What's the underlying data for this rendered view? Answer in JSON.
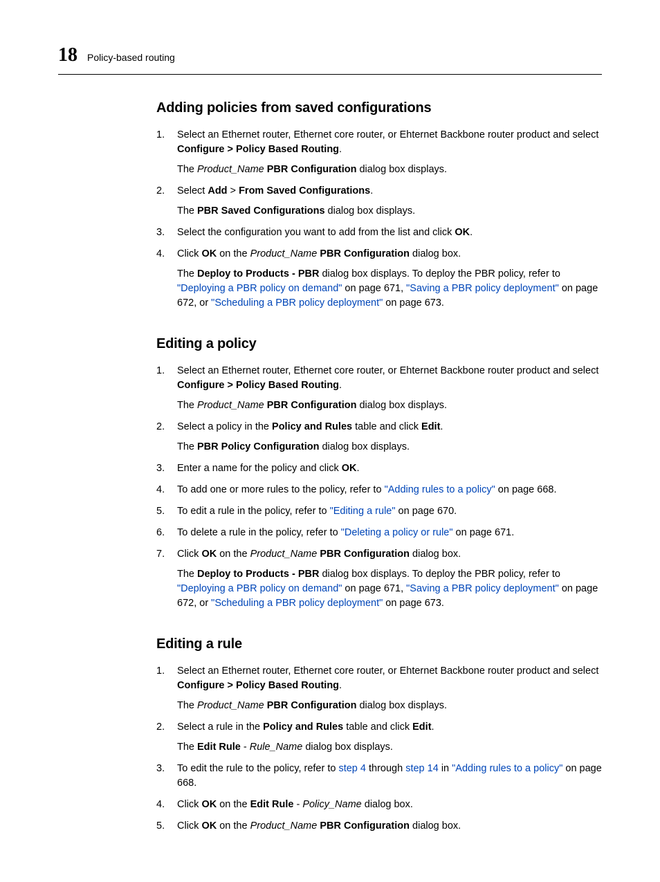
{
  "header": {
    "chapter": "18",
    "title": "Policy-based routing"
  },
  "sections": {
    "s1": {
      "title": "Adding policies from saved configurations",
      "step1_a": "Select an Ethernet router, Ethernet core router, or Ehternet Backbone router product and select ",
      "step1_b": "Configure > Policy Based Routing",
      "step1_c": ".",
      "step1_sub_a": "The ",
      "step1_sub_b": "Product_Name",
      "step1_sub_c": " PBR Configuration",
      "step1_sub_d": " dialog box displays.",
      "step2_a": "Select ",
      "step2_b": "Add",
      "step2_c": " > ",
      "step2_d": "From Saved Configurations",
      "step2_e": ".",
      "step2_sub_a": "The ",
      "step2_sub_b": "PBR Saved Configurations",
      "step2_sub_c": " dialog box displays.",
      "step3_a": "Select the configuration you want to add from the list and click ",
      "step3_b": "OK",
      "step3_c": ".",
      "step4_a": "Click ",
      "step4_b": "OK",
      "step4_c": " on the ",
      "step4_d": "Product_Name",
      "step4_e": " PBR Configuration",
      "step4_f": " dialog box.",
      "step4_sub_a": "The ",
      "step4_sub_b": "Deploy to Products - PBR",
      "step4_sub_c": " dialog box displays. To deploy the PBR policy, refer to ",
      "step4_sub_d": "\"Deploying a PBR policy on demand\"",
      "step4_sub_e": " on page 671, ",
      "step4_sub_f": "\"Saving a PBR policy deployment\"",
      "step4_sub_g": " on page 672, or ",
      "step4_sub_h": "\"Scheduling a PBR policy deployment\"",
      "step4_sub_i": " on page 673."
    },
    "s2": {
      "title": "Editing a policy",
      "step1_a": "Select an Ethernet router, Ethernet core router, or Ehternet Backbone router product and select ",
      "step1_b": "Configure > Policy Based Routing",
      "step1_c": ".",
      "step1_sub_a": "The ",
      "step1_sub_b": "Product_Name",
      "step1_sub_c": " PBR Configuration",
      "step1_sub_d": " dialog box displays.",
      "step2_a": "Select a policy in the ",
      "step2_b": "Policy and Rules",
      "step2_c": " table and click ",
      "step2_d": "Edit",
      "step2_e": ".",
      "step2_sub_a": "The ",
      "step2_sub_b": "PBR Policy Configuration",
      "step2_sub_c": " dialog box displays.",
      "step3_a": "Enter a name for the policy and click ",
      "step3_b": "OK",
      "step3_c": ".",
      "step4_a": "To add one or more rules to the policy, refer to ",
      "step4_b": "\"Adding rules to a policy\"",
      "step4_c": " on page 668.",
      "step5_a": "To edit a rule in the policy, refer to ",
      "step5_b": "\"Editing a rule\"",
      "step5_c": " on page 670.",
      "step6_a": "To delete a rule in the policy, refer to ",
      "step6_b": "\"Deleting a policy or rule\"",
      "step6_c": " on page 671.",
      "step7_a": "Click ",
      "step7_b": "OK",
      "step7_c": " on the ",
      "step7_d": "Product_Name",
      "step7_e": " PBR Configuration",
      "step7_f": " dialog box.",
      "step7_sub_a": "The ",
      "step7_sub_b": "Deploy to Products - PBR",
      "step7_sub_c": " dialog box displays. To deploy the PBR policy, refer to ",
      "step7_sub_d": "\"Deploying a PBR policy on demand\"",
      "step7_sub_e": " on page 671, ",
      "step7_sub_f": "\"Saving a PBR policy deployment\"",
      "step7_sub_g": " on page 672, or ",
      "step7_sub_h": "\"Scheduling a PBR policy deployment\"",
      "step7_sub_i": " on page 673."
    },
    "s3": {
      "title": "Editing a rule",
      "step1_a": "Select an Ethernet router, Ethernet core router, or Ehternet Backbone router product and select ",
      "step1_b": "Configure > Policy Based Routing",
      "step1_c": ".",
      "step1_sub_a": "The ",
      "step1_sub_b": "Product_Name",
      "step1_sub_c": " PBR Configuration",
      "step1_sub_d": " dialog box displays.",
      "step2_a": "Select a rule in the ",
      "step2_b": "Policy and Rules",
      "step2_c": " table and click ",
      "step2_d": "Edit",
      "step2_e": ".",
      "step2_sub_a": "The ",
      "step2_sub_b": "Edit Rule",
      "step2_sub_c": " - ",
      "step2_sub_d": "Rule_Name",
      "step2_sub_e": " dialog box displays.",
      "step3_a": "To edit the rule to the policy, refer to ",
      "step3_b": "step 4",
      "step3_c": " through ",
      "step3_d": "step 14",
      "step3_e": " in ",
      "step3_f": "\"Adding rules to a policy\"",
      "step3_g": " on page 668.",
      "step4_a": "Click ",
      "step4_b": "OK",
      "step4_c": " on the ",
      "step4_d": "Edit Rule",
      "step4_e": " - ",
      "step4_f": "Policy_Name",
      "step4_g": " dialog box.",
      "step5_a": "Click ",
      "step5_b": "OK",
      "step5_c": " on the ",
      "step5_d": "Product_Name",
      "step5_e": " PBR Configuration",
      "step5_f": " dialog box."
    }
  }
}
